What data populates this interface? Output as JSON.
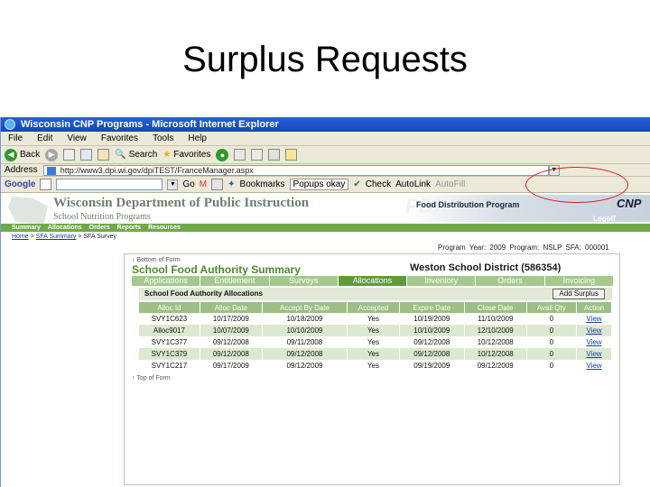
{
  "slide": {
    "title": "Surplus Requests"
  },
  "browser": {
    "window_title": "Wisconsin CNP Programs - Microsoft Internet Explorer",
    "menu": [
      "File",
      "Edit",
      "View",
      "Favorites",
      "Tools",
      "Help"
    ],
    "toolbar": {
      "back": "Back",
      "search": "Search",
      "favorites": "Favorites"
    },
    "address_label": "Address",
    "address_value": "http://www3.dpi.wi.gov/dpiTEST/FranceManager.aspx",
    "google": {
      "label": "Google",
      "go": "Go",
      "bookmarks": "Bookmarks",
      "popups": "Popups okay",
      "check": "Check",
      "autolink": "AutoLink",
      "autofill": "AutoFill"
    }
  },
  "site": {
    "dept_title": "Wisconsin Department of Public Instruction",
    "dept_sub": "School Nutrition Programs",
    "fdp_logo": "FDP",
    "fdp_text": "Food Distribution Program",
    "cnp_logo": "CNP",
    "logoff": "Logoff",
    "nav": [
      "Summary",
      "Allocations",
      "Orders",
      "Reports",
      "Resources"
    ],
    "breadcrumb": {
      "home": "Home",
      "sfa_summary": "SFA Summary",
      "sfa_survey": "SFA Survey"
    },
    "program_info": "Program Year: 2009  Program: NSLP  SFA: 000001"
  },
  "panel": {
    "bottom_of_form": "Bottom of Form",
    "title": "School Food Authority Summary",
    "district": "Weston School District (586354)",
    "tabs": [
      "Applications",
      "Entitlement",
      "Surveys",
      "Allocations",
      "Inventory",
      "Orders",
      "Invoicing"
    ],
    "active_tab": "Allocations",
    "section_title": "School Food Authority Allocations",
    "add_button": "Add Surplus",
    "columns": [
      "Alloc Id",
      "Alloc Date",
      "Accept By Date",
      "Accepted",
      "Expire Date",
      "Close Date",
      "Avail Qty",
      "Action"
    ],
    "rows": [
      [
        "SVY1C623",
        "10/17/2009",
        "10/18/2009",
        "Yes",
        "10/19/2009",
        "11/10/2009",
        "0",
        "View"
      ],
      [
        "Alloc9017",
        "10/07/2009",
        "10/10/2009",
        "Yes",
        "10/10/2009",
        "12/10/2009",
        "0",
        "View"
      ],
      [
        "SVY1C377",
        "09/12/2008",
        "09/11/2008",
        "Yes",
        "09/12/2008",
        "10/12/2008",
        "0",
        "View"
      ],
      [
        "SVY1C379",
        "09/12/2008",
        "09/12/2008",
        "Yes",
        "09/12/2008",
        "10/12/2008",
        "0",
        "View"
      ],
      [
        "SVY1C217",
        "09/17/2009",
        "09/12/2009",
        "Yes",
        "09/19/2009",
        "09/12/2009",
        "0",
        "View"
      ]
    ],
    "top_of_form": "Top of Form"
  }
}
